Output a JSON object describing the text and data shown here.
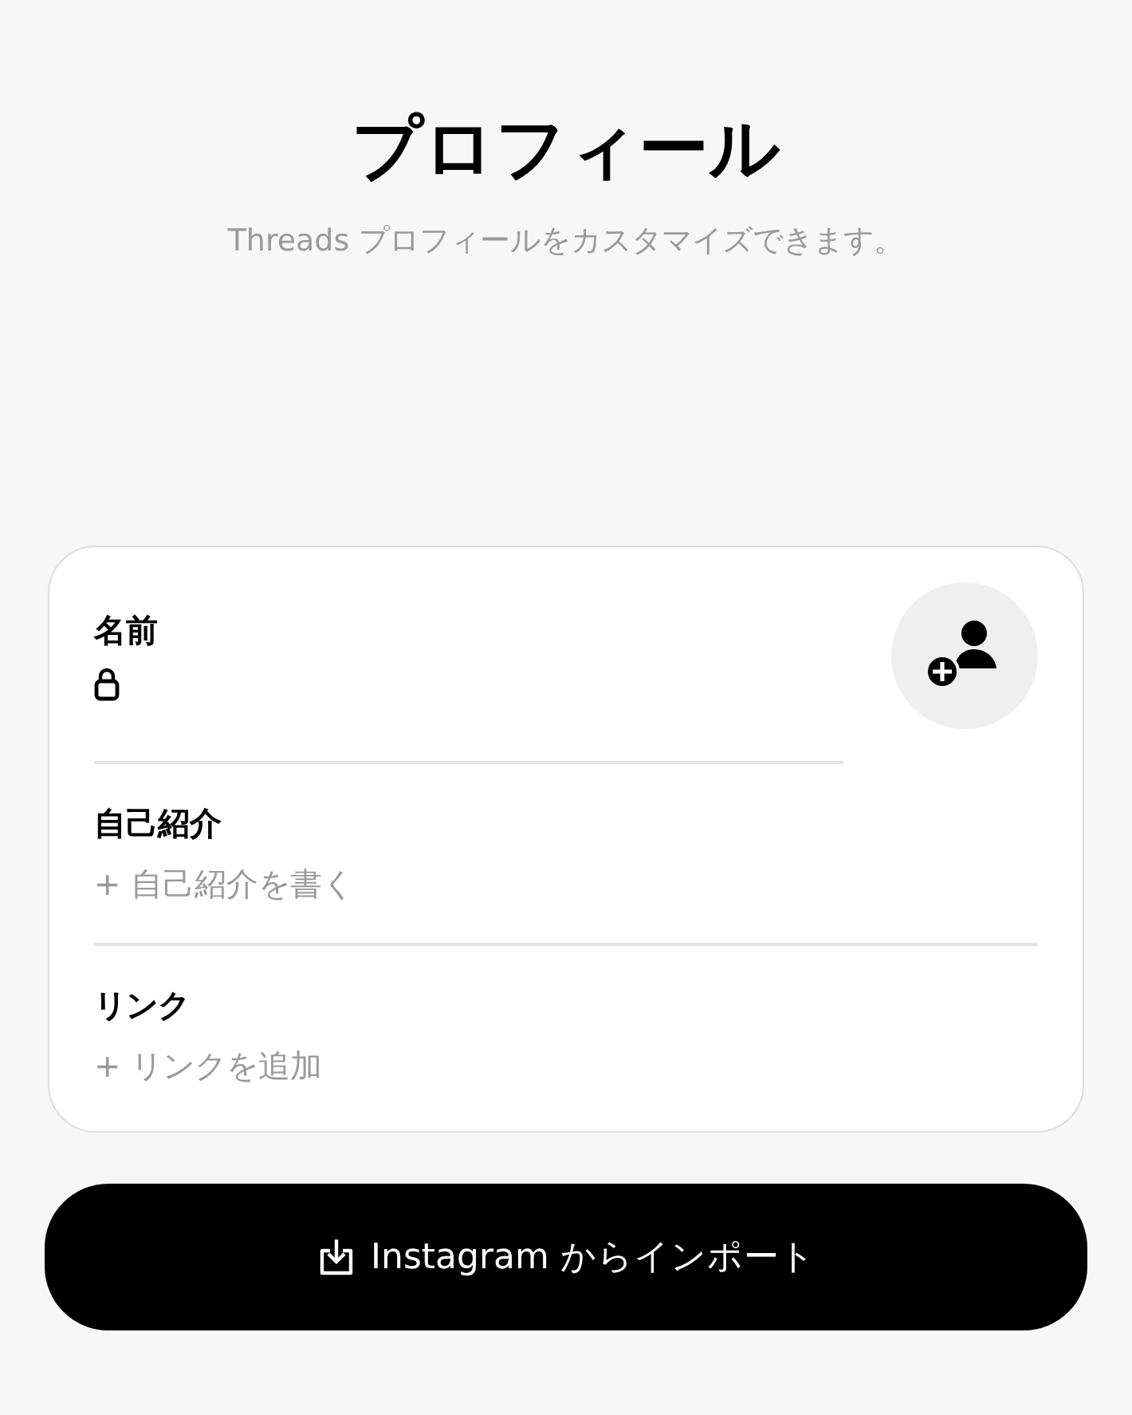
{
  "header": {
    "title": "プロフィール",
    "subtitle": "Threads プロフィールをカスタマイズできます。"
  },
  "fields": [
    {
      "label": "名前",
      "locked": true
    },
    {
      "label": "自己紹介",
      "placeholder": "+ 自己紹介を書く",
      "locked": false
    },
    {
      "label": "リンク",
      "placeholder": "+ リンクを追加",
      "locked": false
    }
  ],
  "import_button": {
    "label": "Instagram からインポート"
  }
}
